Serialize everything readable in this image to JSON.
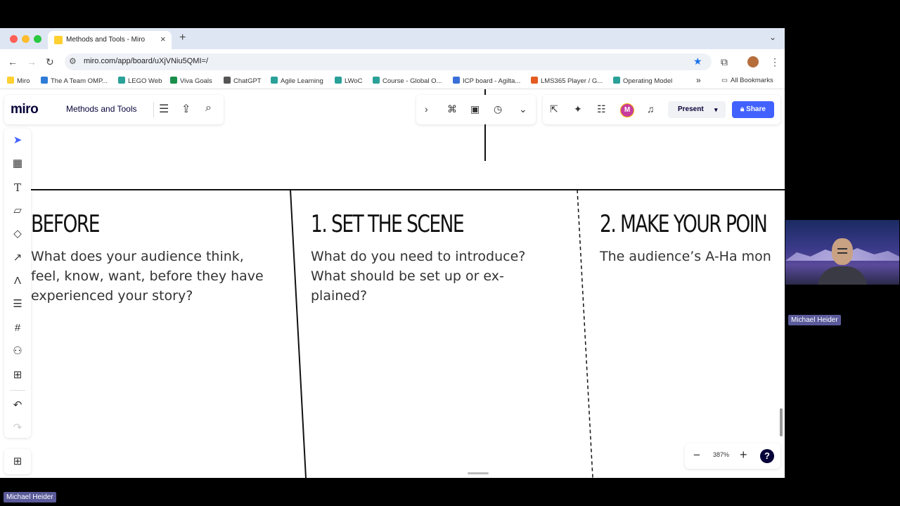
{
  "browser": {
    "tab": {
      "title": "Methods and Tools - Miro"
    },
    "url": "miro.com/app/board/uXjVNiu5QMI=/",
    "bookmarks": [
      {
        "label": "Miro",
        "color": "#ffd02f"
      },
      {
        "label": "The A Team OMP...",
        "color": "#2f7bd6"
      },
      {
        "label": "LEGO Web",
        "color": "#2aa198"
      },
      {
        "label": "Viva Goals",
        "color": "#1a8f4a"
      },
      {
        "label": "ChatGPT",
        "color": "#555555"
      },
      {
        "label": "Agile Learning",
        "color": "#2aa198"
      },
      {
        "label": "LWoC",
        "color": "#2aa198"
      },
      {
        "label": "Course - Global O...",
        "color": "#2aa198"
      },
      {
        "label": "ICP board - Agilta...",
        "color": "#3a6fd8"
      },
      {
        "label": "LMS365 Player / G...",
        "color": "#e35b21"
      },
      {
        "label": "Operating Model",
        "color": "#2aa198"
      }
    ],
    "all_bookmarks": "All Bookmarks"
  },
  "miro": {
    "logo": "miro",
    "board_title": "Methods and Tools",
    "present_label": "Present",
    "share_label": "Share",
    "user_initial": "M",
    "zoom": "387%"
  },
  "board": {
    "col1": {
      "heading": "BEFORE",
      "text": "What does your audience think,\nfeel, know, want, before they have\nexperienced your story?"
    },
    "col2": {
      "heading": "1. SET THE SCENE",
      "text": "What do you need to introduce?\nWhat should be set up or ex-\nplained?"
    },
    "col3": {
      "heading": "2. MAKE YOUR POIN",
      "text": "The audience’s A-Ha mon"
    }
  },
  "participants": {
    "webcam_name": "Michael Heider",
    "self_name": "Michael Heider"
  },
  "colors": {
    "brand_blue": "#4262ff",
    "miro_yellow": "#ffd02f"
  }
}
